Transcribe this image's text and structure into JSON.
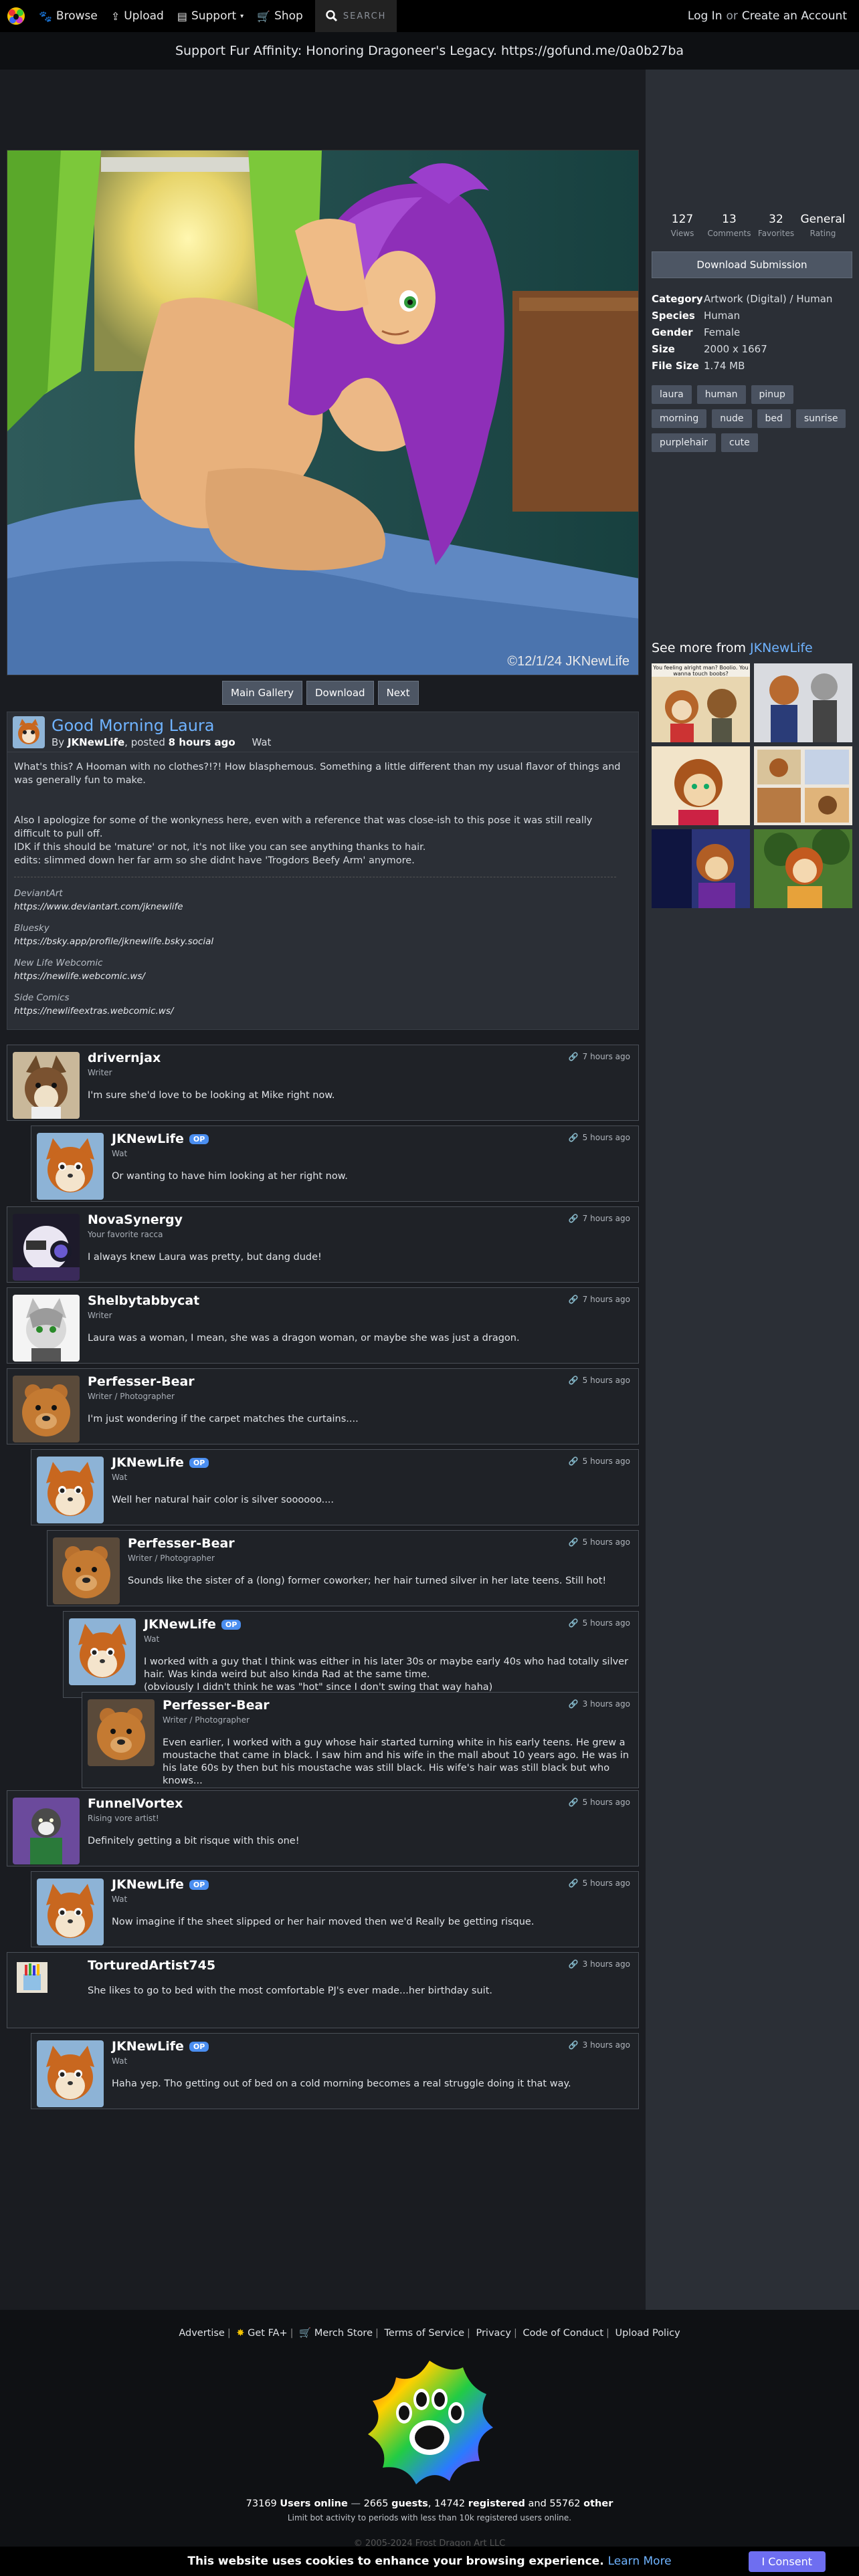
{
  "nav": {
    "browse": "Browse",
    "upload": "Upload",
    "support": "Support",
    "shop": "Shop",
    "search_label": "SEARCH",
    "login": "Log In",
    "or": "or",
    "create": "Create an Account"
  },
  "banner": "Support Fur Affinity: Honoring Dragoneer's Legacy. https://gofund.me/0a0b27ba",
  "stats": [
    {
      "value": "127",
      "label": "Views"
    },
    {
      "value": "13",
      "label": "Comments"
    },
    {
      "value": "32",
      "label": "Favorites"
    },
    {
      "value": "General",
      "label": "Rating"
    }
  ],
  "download_label": "Download Submission",
  "info": {
    "category_k": "Category",
    "category_v": "Artwork (Digital) / Human",
    "species_k": "Species",
    "species_v": "Human",
    "gender_k": "Gender",
    "gender_v": "Female",
    "size_k": "Size",
    "size_v": "2000 x 1667",
    "filesize_k": "File Size",
    "filesize_v": "1.74 MB"
  },
  "tags": [
    "laura",
    "human",
    "pinup",
    "morning",
    "nude",
    "bed",
    "sunrise",
    "purplehair",
    "cute"
  ],
  "see_more_prefix": "See more from ",
  "see_more_user": "JKNewLife",
  "thumb_caption": "You feeling alright man? Boolio. You wanna touch boobs?",
  "image_watermark": "©12/1/24 JKNewLife",
  "gallery_buttons": {
    "main": "Main Gallery",
    "download": "Download",
    "next": "Next"
  },
  "submission": {
    "title": "Good Morning Laura",
    "by": "By",
    "author": "JKNewLife",
    "posted": ", posted",
    "time": "8 hours ago",
    "rating": "Wat",
    "p1": "What's this? A Hooman with no clothes?!?! How blasphemous. Something a little different than my usual flavor of things and was generally fun to make.",
    "p2": "Also I apologize for some of the wonkyness here, even with a reference that was close-ish to this pose it was still really difficult to pull off.",
    "p3": "IDK if this should be 'mature' or not, it's not like you can see anything thanks to hair.",
    "p4": "edits: slimmed down her far arm so she didnt have 'Trogdors Beefy Arm' anymore.",
    "links": [
      {
        "title": "DeviantArt",
        "url": "https://www.deviantart.com/jknewlife"
      },
      {
        "title": "Bluesky",
        "url": "https://bsky.app/profile/jknewlife.bsky.social"
      },
      {
        "title": "New Life Webcomic",
        "url": "https://newlife.webcomic.ws/"
      },
      {
        "title": "Side Comics",
        "url": "https://newlifeextras.webcomic.ws/"
      }
    ]
  },
  "comments": [
    {
      "name": "drivernjax",
      "title": "Writer",
      "text": "I'm sure she'd love to be looking at Mike right now.",
      "time": "7 hours ago",
      "op": ""
    },
    {
      "name": "JKNewLife",
      "title": "Wat",
      "text": "Or wanting to have him looking at her right now.",
      "time": "5 hours ago",
      "op": "OP"
    },
    {
      "name": "NovaSynergy",
      "title": "Your favorite racca",
      "text": "I always knew Laura was pretty, but dang dude!",
      "time": "7 hours ago",
      "op": ""
    },
    {
      "name": "Shelbytabbycat",
      "title": "Writer",
      "text": "Laura was a woman, I mean, she was a dragon woman, or maybe she was just a dragon.",
      "time": "7 hours ago",
      "op": ""
    },
    {
      "name": "Perfesser-Bear",
      "title": "Writer / Photographer",
      "text": "I'm just wondering if the carpet matches the curtains....",
      "time": "5 hours ago",
      "op": ""
    },
    {
      "name": "JKNewLife",
      "title": "Wat",
      "text": "Well her natural hair color is silver soooooo....",
      "time": "5 hours ago",
      "op": "OP"
    },
    {
      "name": "Perfesser-Bear",
      "title": "Writer / Photographer",
      "text": "Sounds like the sister of a (long) former coworker; her hair turned silver in her late teens. Still hot!",
      "time": "5 hours ago",
      "op": ""
    },
    {
      "name": "JKNewLife",
      "title": "Wat",
      "text": "I worked with a guy that I think was either in his later 30s or maybe early 40s who had totally silver hair. Was kinda weird but also kinda Rad at the same time.\n(obviously I didn't think he was \"hot\" since I don't swing that way haha)",
      "time": "5 hours ago",
      "op": "OP"
    },
    {
      "name": "Perfesser-Bear",
      "title": "Writer / Photographer",
      "text": "Even earlier, I worked with a guy whose hair started turning white in his early teens. He grew a moustache that came in black. I saw him and his wife in the mall about 10 years ago. He was in his late 60s by then but his moustache was still black. His wife's hair was still black but who knows...",
      "time": "3 hours ago",
      "op": ""
    },
    {
      "name": "FunnelVortex",
      "title": "Rising vore artist!",
      "text": "Definitely getting a bit risque with this one!",
      "time": "5 hours ago",
      "op": ""
    },
    {
      "name": "JKNewLife",
      "title": "Wat",
      "text": "Now imagine if the sheet slipped or her hair moved then we'd Really be getting risque.",
      "time": "5 hours ago",
      "op": "OP"
    },
    {
      "name": "TorturedArtist745",
      "title": "",
      "text": "She likes to go to bed with the most comfortable PJ's ever made...her birthday suit.",
      "time": "3 hours ago",
      "op": ""
    },
    {
      "name": "JKNewLife",
      "title": "Wat",
      "text": "Haha yep. Tho getting out of bed on a cold morning becomes a real struggle doing it that way.",
      "time": "3 hours ago",
      "op": "OP"
    }
  ],
  "footer": {
    "advertise": "Advertise",
    "getfa": "Get FA+",
    "merch": "Merch Store",
    "terms": "Terms of Service",
    "privacy": "Privacy",
    "conduct": "Code of Conduct",
    "upload_policy": "Upload Policy",
    "users_online": "73169",
    "users_online_label": "Users online",
    "guests": "2665",
    "guests_label": "guests",
    "registered": "14742",
    "registered_label": "registered",
    "and": "and",
    "other": "55762",
    "other_label": "other",
    "limit": "Limit bot activity to periods with less than 10k registered users online.",
    "copyright": "© 2005-2024 Frost Dragon Art LLC"
  },
  "cookie": {
    "message": "This website uses cookies to enhance your browsing experience.",
    "learn_more": "Learn More",
    "consent": "I Consent"
  }
}
